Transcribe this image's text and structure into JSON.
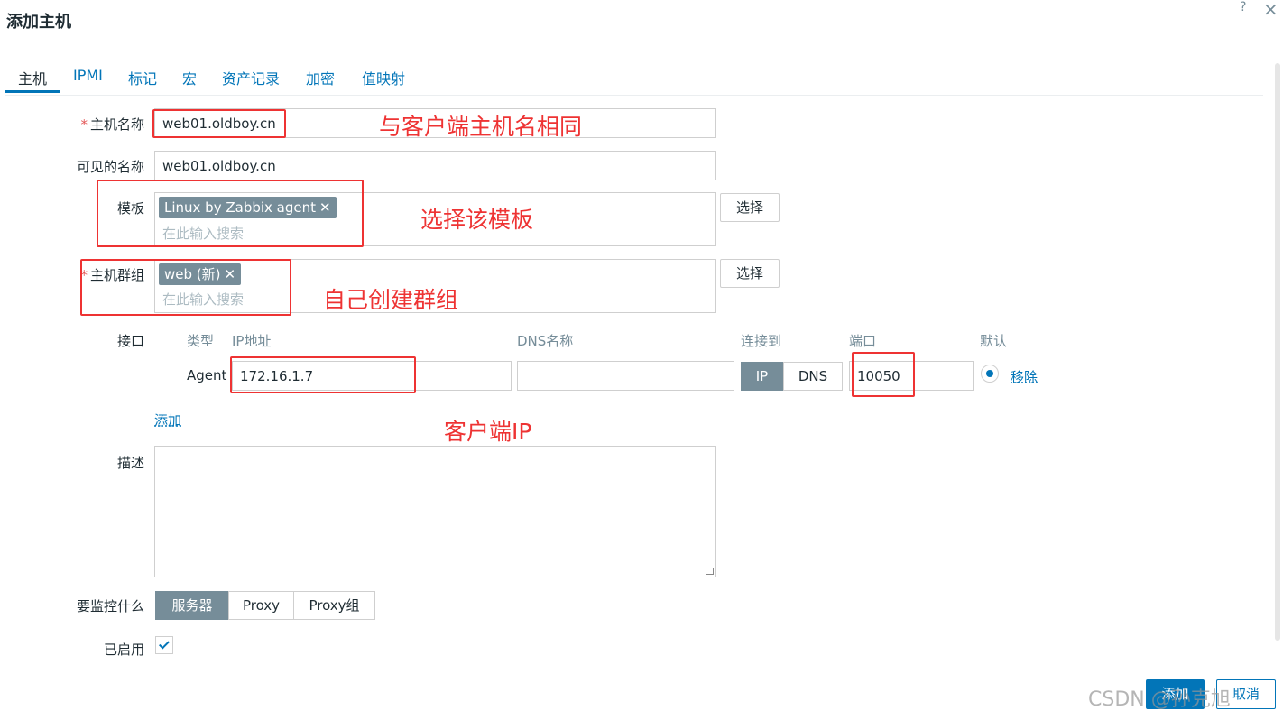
{
  "dialog": {
    "title": "添加主机",
    "help_icon": "?",
    "close_icon": "×"
  },
  "tabs": [
    {
      "label": "主机",
      "active": true
    },
    {
      "label": "IPMI"
    },
    {
      "label": "标记"
    },
    {
      "label": "宏"
    },
    {
      "label": "资产记录"
    },
    {
      "label": "加密"
    },
    {
      "label": "值映射"
    }
  ],
  "form": {
    "host_name": {
      "label": "主机名称",
      "required_mark": "*",
      "value": "web01.oldboy.cn"
    },
    "visible_name": {
      "label": "可见的名称",
      "value": "web01.oldboy.cn"
    },
    "templates": {
      "label": "模板",
      "chip": "Linux by Zabbix agent",
      "chip_remove": "✕",
      "placeholder": "在此输入搜索",
      "select_button": "选择"
    },
    "host_groups": {
      "label": "主机群组",
      "required_mark": "*",
      "chip": "web (新)",
      "chip_remove": "✕",
      "placeholder": "在此输入搜索",
      "select_button": "选择"
    },
    "interfaces": {
      "label": "接口",
      "headers": {
        "type": "类型",
        "ip": "IP地址",
        "dns": "DNS名称",
        "connect_to": "连接到",
        "port": "端口",
        "default": "默认"
      },
      "row": {
        "type": "Agent",
        "ip": "172.16.1.7",
        "dns": "",
        "connect_ip": "IP",
        "connect_dns": "DNS",
        "connect_selected": "IP",
        "port": "10050",
        "remove": "移除"
      },
      "add_link": "添加"
    },
    "description": {
      "label": "描述",
      "value": ""
    },
    "monitored_by": {
      "label": "要监控什么",
      "options": [
        "服务器",
        "Proxy",
        "Proxy组"
      ],
      "selected": "服务器"
    },
    "enabled": {
      "label": "已启用",
      "checked": true
    }
  },
  "footer": {
    "add_button": "添加",
    "cancel_button": "取消"
  },
  "annotations": {
    "host_name_note": "与客户端主机名相同",
    "template_note": "选择该模板",
    "group_note": "自己创建群组",
    "ip_note": "客户端IP"
  },
  "watermark": "CSDN @孙克旭"
}
